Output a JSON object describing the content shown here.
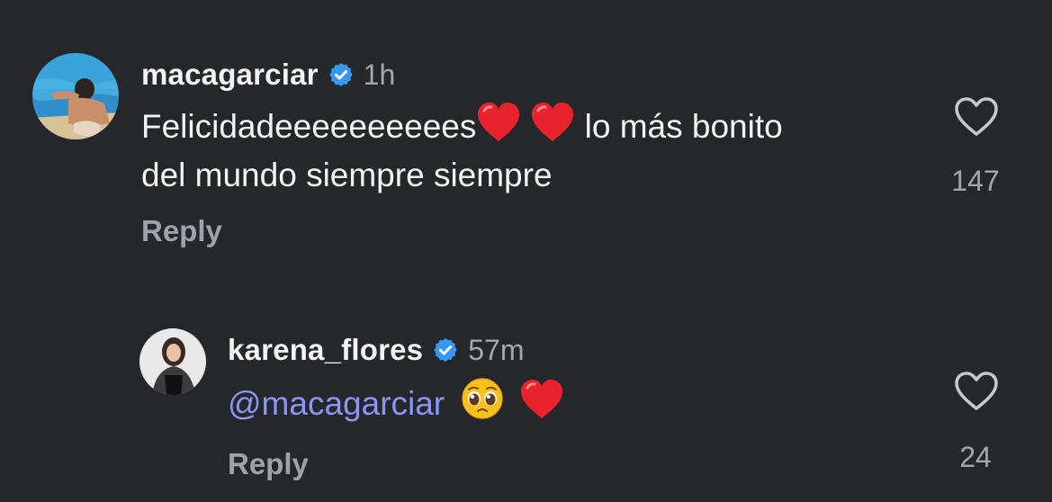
{
  "comments": [
    {
      "username": "macagarciar",
      "time": "1h",
      "text_line1": "Felicidadeeeeeeeeees",
      "text_line1_after": " lo más bonito",
      "text_line2": "del mundo siempre siempre",
      "reply_label": "Reply",
      "like_count": "147",
      "avatar_icon": "avatar-pool-photo"
    },
    {
      "username": "karena_flores",
      "time": "57m",
      "mention": "@macagarciar",
      "reply_label": "Reply",
      "like_count": "24",
      "avatar_icon": "avatar-portrait-photo"
    }
  ],
  "icons": {
    "verified": "verified-badge-icon",
    "heart": "heart-outline-icon",
    "red_heart_emoji": "red-heart-emoji",
    "pleading_face_emoji": "pleading-face-emoji"
  },
  "colors": {
    "background": "#25272b",
    "verified_blue": "#3897f0",
    "mention": "#8b95f4",
    "heart_red": "#e8232e"
  }
}
